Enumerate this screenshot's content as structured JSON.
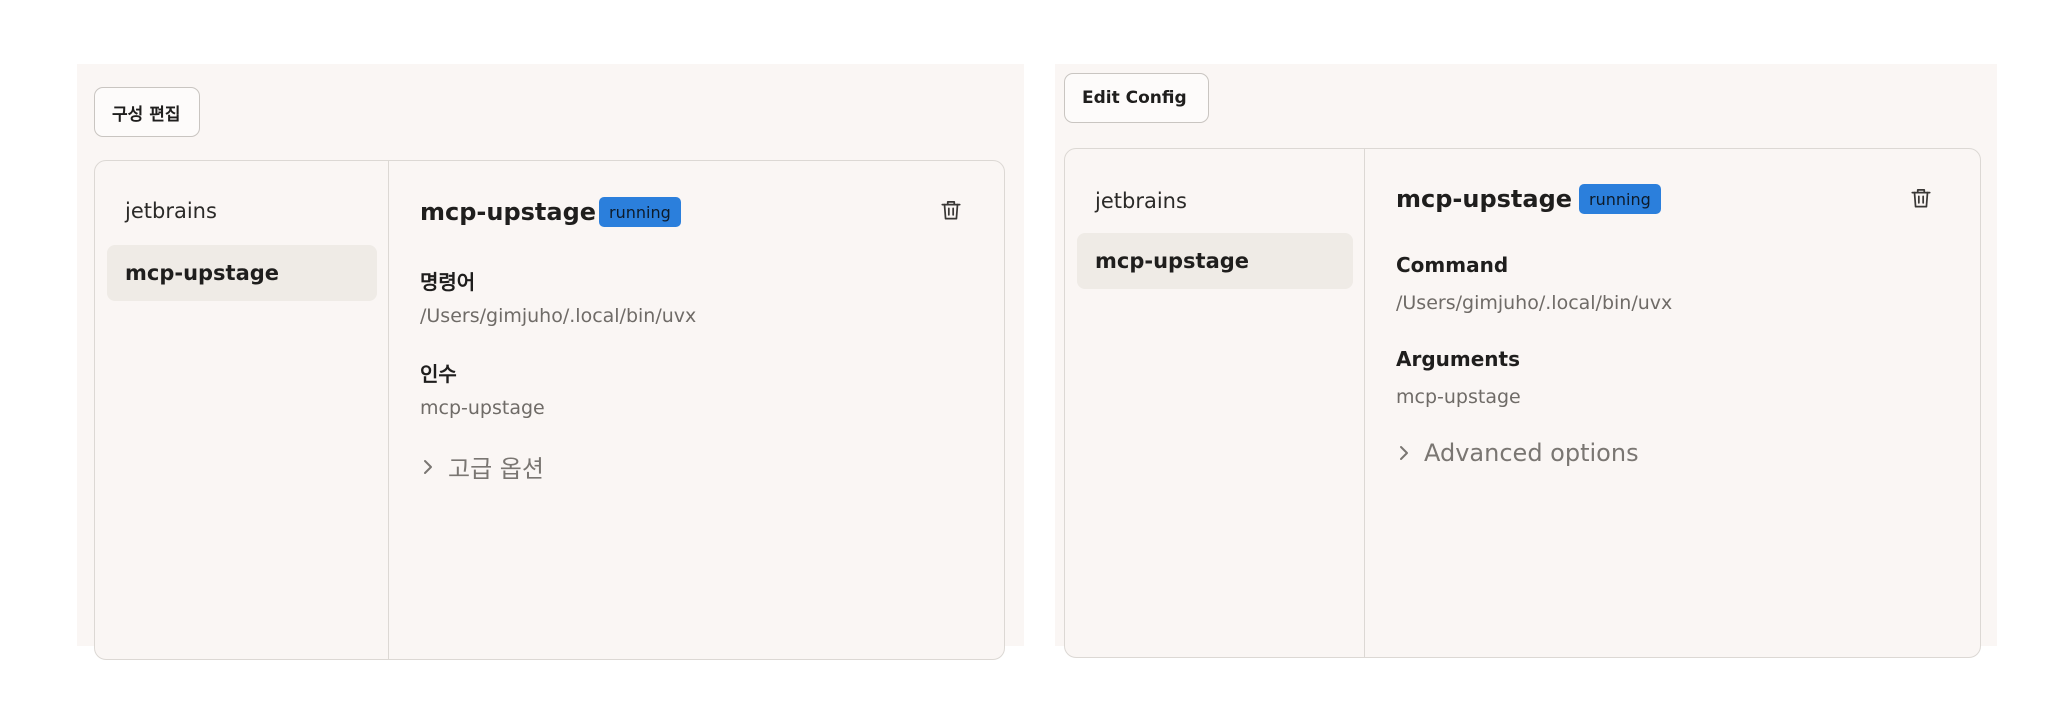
{
  "panels": [
    {
      "edit_button": "구성 편집",
      "sidebar": [
        "jetbrains",
        "mcp-upstage"
      ],
      "server": {
        "name": "mcp-upstage",
        "status": "running",
        "command_label": "명령어",
        "command_value": "/Users/gimjuho/.local/bin/uvx",
        "arguments_label": "인수",
        "arguments_value": "mcp-upstage",
        "advanced_label": "고급 옵션"
      }
    },
    {
      "edit_button": "Edit Config",
      "sidebar": [
        "jetbrains",
        "mcp-upstage"
      ],
      "server": {
        "name": "mcp-upstage",
        "status": "running",
        "command_label": "Command",
        "command_value": "/Users/gimjuho/.local/bin/uvx",
        "arguments_label": "Arguments",
        "arguments_value": "mcp-upstage",
        "advanced_label": "Advanced options"
      }
    }
  ],
  "icons": {
    "delete": "trash-icon",
    "expand": "chevron-right-icon"
  },
  "colors": {
    "status_badge": "#2b7fdc",
    "panel_bg": "#faf6f4",
    "active_item_bg": "#efebe6"
  }
}
